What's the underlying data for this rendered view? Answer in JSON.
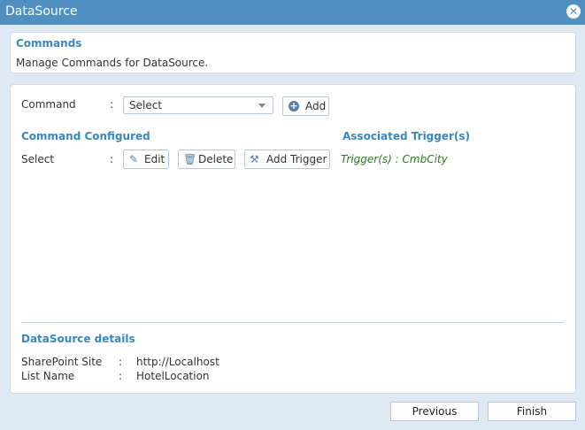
{
  "window": {
    "title": "DataSource",
    "close_glyph": "✕"
  },
  "commands_panel": {
    "heading": "Commands",
    "description": "Manage Commands for DataSource."
  },
  "command_row": {
    "label": "Command",
    "colon": ":",
    "select_value": "Select",
    "add_label": "Add"
  },
  "configured": {
    "heading": "Command Configured",
    "triggers_heading": "Associated Trigger(s)",
    "row": {
      "name": "Select",
      "colon": ":",
      "edit_label": "Edit",
      "delete_label": "Delete",
      "add_trigger_label": "Add Trigger",
      "trigger_text": "Trigger(s) : CmbCity"
    }
  },
  "details": {
    "heading": "DataSource details",
    "rows": [
      {
        "label": "SharePoint Site",
        "colon": ":",
        "value": "http://Localhost"
      },
      {
        "label": "List Name",
        "colon": ":",
        "value": "HotelLocation"
      }
    ]
  },
  "footer": {
    "previous_label": "Previous",
    "finish_label": "Finish"
  },
  "icons": {
    "add": "plus-circle-icon",
    "edit": "pencil-icon",
    "delete": "trash-icon",
    "add_trigger": "tools-icon",
    "close": "close-icon"
  },
  "colors": {
    "titlebar": "#4f8fc2",
    "heading": "#3a86bf",
    "trigger": "#2b7a1e",
    "background": "#dfe9f3"
  }
}
